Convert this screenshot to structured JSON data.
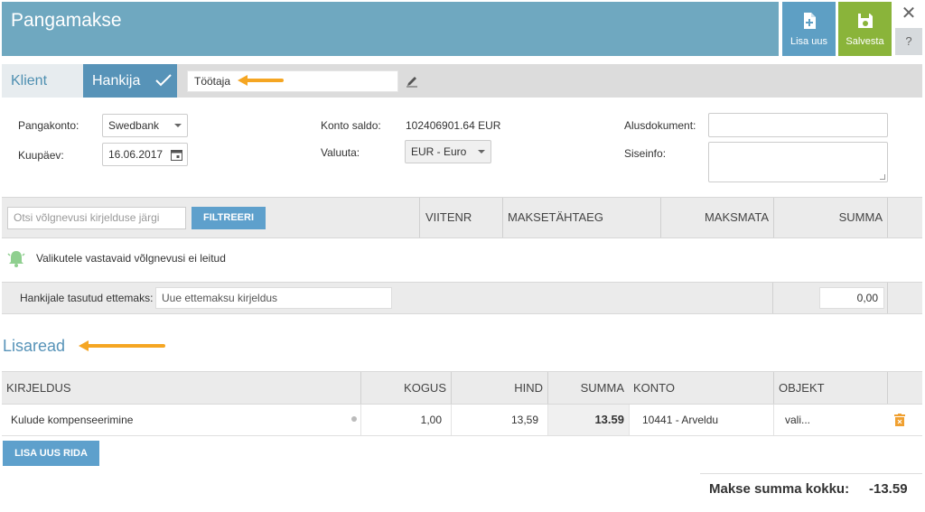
{
  "header": {
    "title": "Pangamakse",
    "add_new_label": "Lisa uus",
    "save_label": "Salvesta",
    "close_symbol": "✕",
    "help_symbol": "?"
  },
  "tabs": {
    "client_label": "Klient",
    "supplier_label": "Hankija",
    "party_value": "Töötaja"
  },
  "form": {
    "bank_account_label": "Pangakonto:",
    "bank_account_value": "Swedbank",
    "date_label": "Kuupäev:",
    "date_value": "16.06.2017",
    "balance_label": "Konto saldo:",
    "balance_value": "102406901.64 EUR",
    "currency_label": "Valuuta:",
    "currency_value": "EUR - Euro",
    "base_document_label": "Alusdokument:",
    "base_document_value": "",
    "internal_info_label": "Siseinfo:",
    "internal_info_value": ""
  },
  "debts": {
    "search_placeholder": "Otsi võlgnevusi kirjelduse järgi",
    "filter_label": "FILTREERI",
    "columns": [
      "VIITENR",
      "MAKSETÄHTAEG",
      "MAKSMATA",
      "SUMMA"
    ],
    "empty_message": "Valikutele vastavaid võlgnevusi ei leitud",
    "prepayment_label": "Hankijale tasutud ettemaks:",
    "prepayment_placeholder": "Uue ettemaksu kirjeldus",
    "prepayment_amount": "0,00"
  },
  "lines": {
    "title": "Lisaread",
    "columns": {
      "description": "KIRJELDUS",
      "quantity": "KOGUS",
      "price": "HIND",
      "sum": "SUMMA",
      "account": "KONTO",
      "object": "OBJEKT"
    },
    "rows": [
      {
        "description": "Kulude kompenseerimine",
        "quantity": "1,00",
        "price": "13,59",
        "sum": "13.59",
        "account": "10441 - Arveldu",
        "object": "vali..."
      }
    ],
    "add_row_label": "LISA UUS RIDA"
  },
  "total": {
    "label": "Makse summa kokku:",
    "value": "-13.59"
  },
  "colors": {
    "header_bg": "#6fa8c0",
    "accent_blue": "#5ea0cc",
    "save_green": "#8ab43a",
    "arrow_orange": "#f5a623",
    "trash_orange": "#f0a030"
  },
  "icons": {
    "add_new": "document-plus-icon",
    "save": "floppy-disk-icon",
    "close": "close-icon",
    "help": "question-icon",
    "check": "checkmark-icon",
    "edit": "pencil-icon",
    "calendar": "calendar-icon",
    "bell": "bell-icon",
    "trash": "trash-icon",
    "arrow": "arrow-left-icon"
  }
}
